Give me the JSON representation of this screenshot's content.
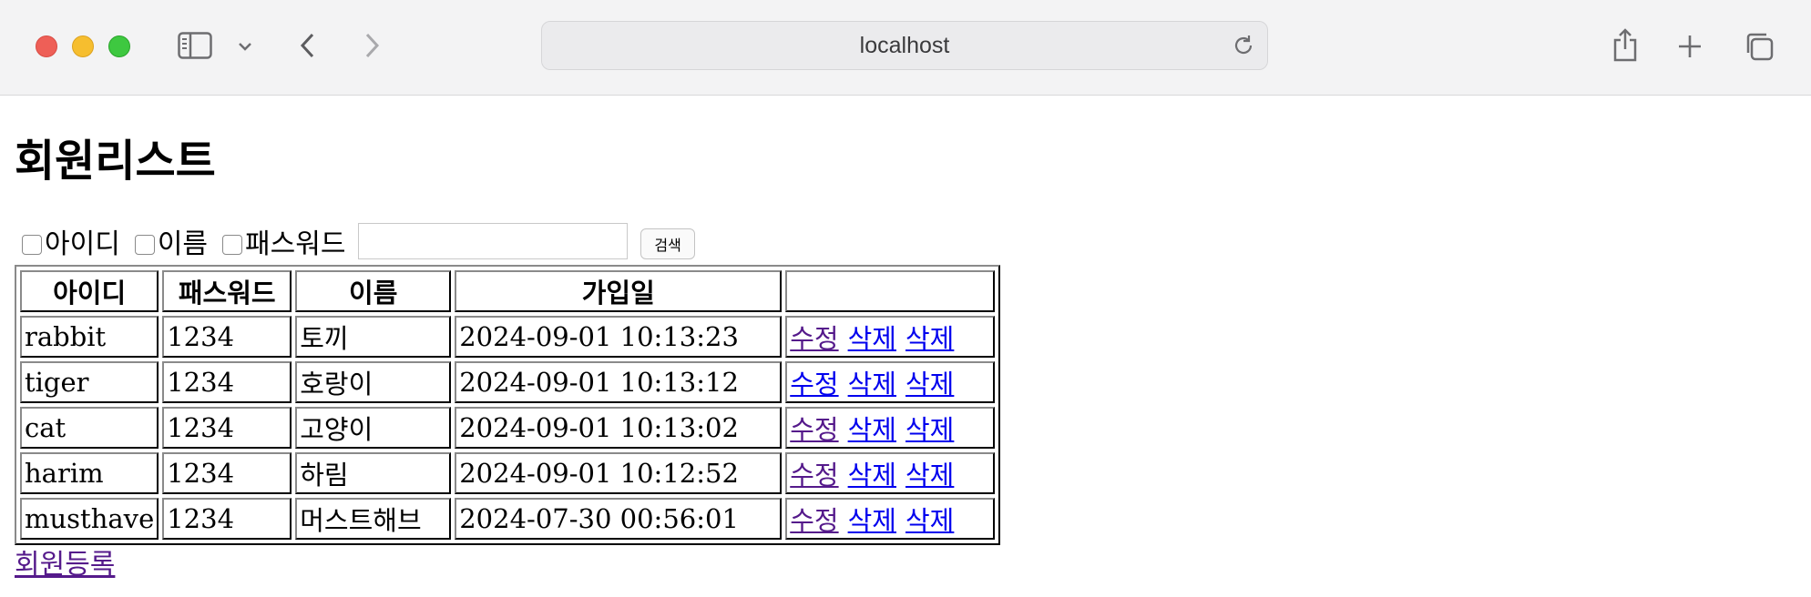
{
  "browser": {
    "url": "localhost"
  },
  "page": {
    "title": "회원리스트",
    "search": {
      "checkboxes": [
        {
          "label": "아이디",
          "checked": false
        },
        {
          "label": "이름",
          "checked": false
        },
        {
          "label": "패스워드",
          "checked": false
        }
      ],
      "input_value": "",
      "button_label": "검색"
    },
    "table": {
      "headers": [
        "아이디",
        "패스워드",
        "이름",
        "가입일",
        ""
      ],
      "rows": [
        {
          "id": "rabbit",
          "password": "1234",
          "name": "토끼",
          "joined": "2024-09-01 10:13:23"
        },
        {
          "id": "tiger",
          "password": "1234",
          "name": "호랑이",
          "joined": "2024-09-01 10:13:12"
        },
        {
          "id": "cat",
          "password": "1234",
          "name": "고양이",
          "joined": "2024-09-01 10:13:02"
        },
        {
          "id": "harim",
          "password": "1234",
          "name": "하림",
          "joined": "2024-09-01 10:12:52"
        },
        {
          "id": "musthave",
          "password": "1234",
          "name": "머스트해브",
          "joined": "2024-07-30 00:56:01"
        }
      ],
      "actions": [
        "수정",
        "삭제",
        "삭제"
      ]
    },
    "register_link": "회원등록"
  },
  "colors": {
    "link": "#0000ee",
    "visited_link": "#551a8b"
  }
}
